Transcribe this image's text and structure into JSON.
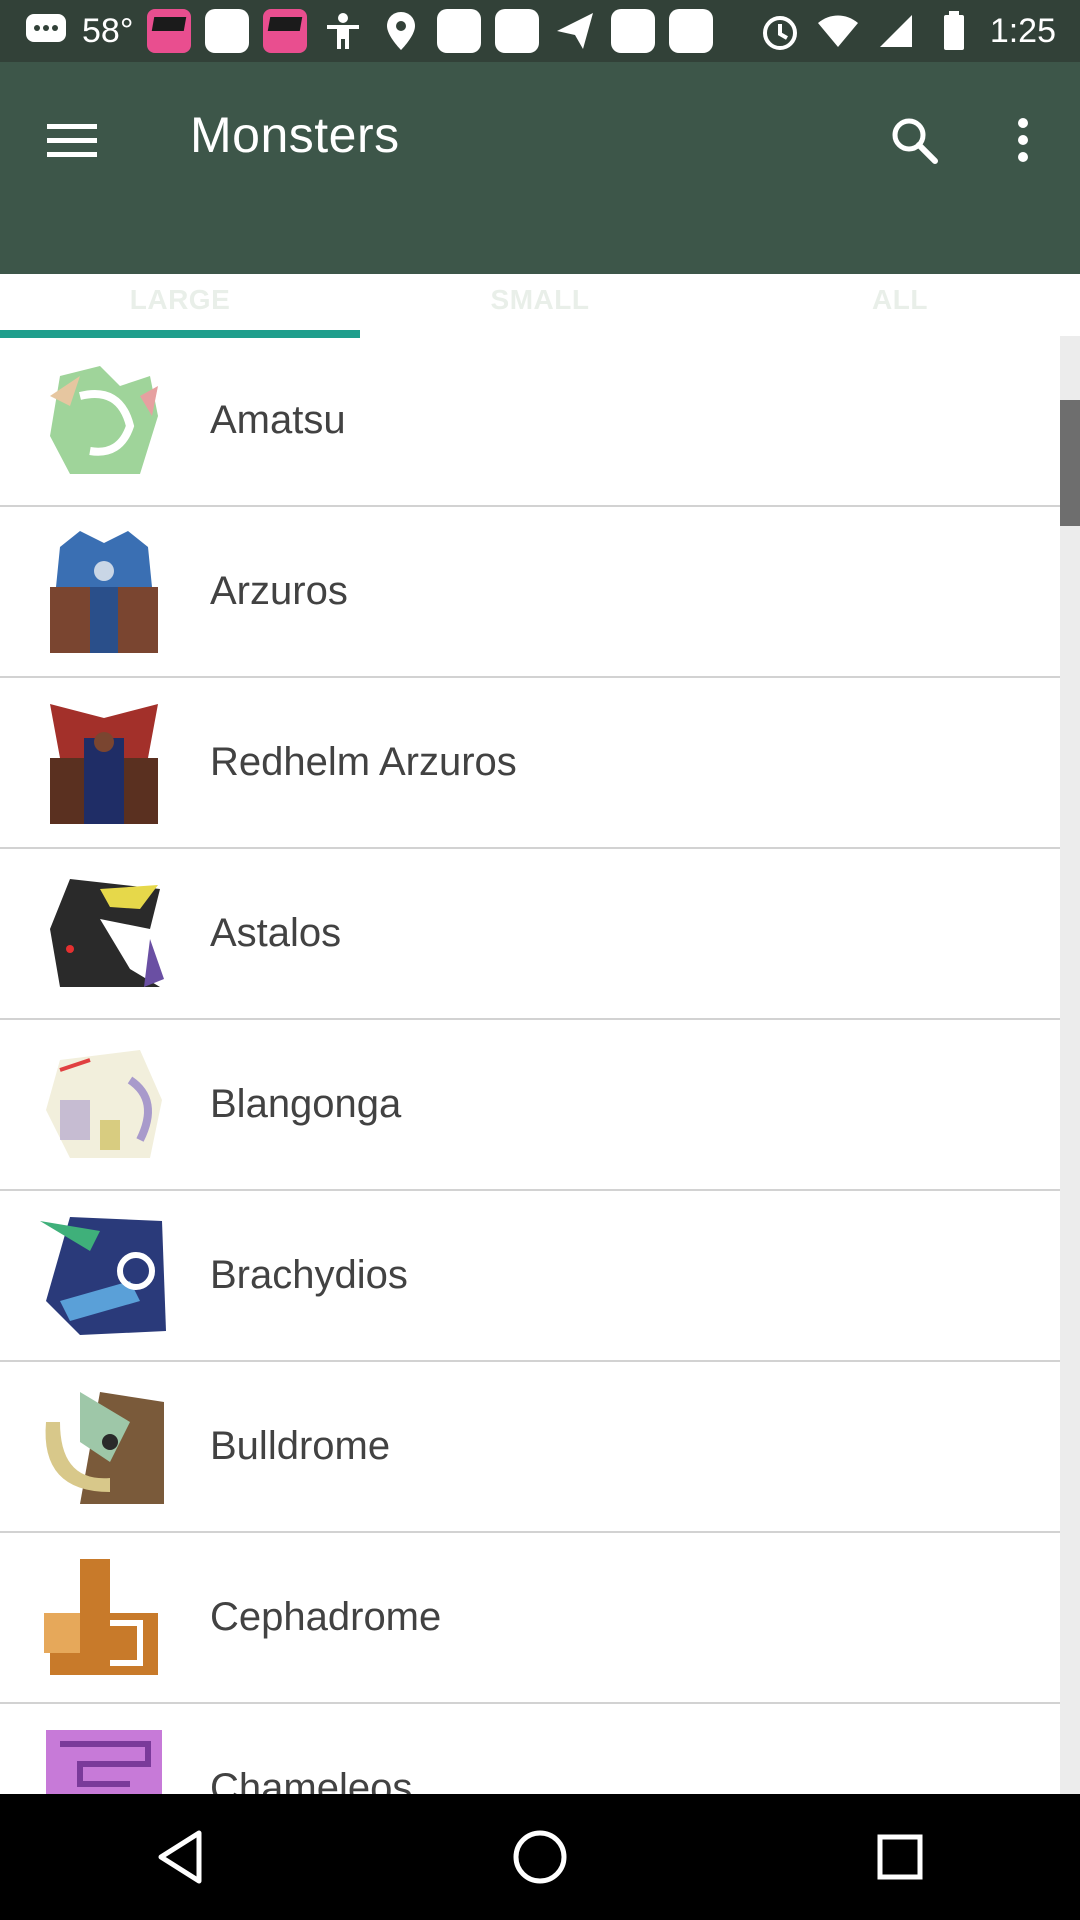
{
  "status_bar": {
    "temperature": "58°",
    "time": "1:25",
    "icons": [
      "messages-icon",
      "pop-app-icon",
      "square-app-icon",
      "pop-app-icon",
      "square-app-icon",
      "accessibility-icon",
      "location-icon",
      "square-app-icon",
      "square-app-icon",
      "send-icon",
      "square-app-icon",
      "square-app-icon",
      "alarm-icon",
      "wifi-icon",
      "signal-icon",
      "battery-icon"
    ]
  },
  "app_bar": {
    "title": "Monsters",
    "tabs": [
      {
        "label": "LARGE",
        "active": true
      },
      {
        "label": "SMALL",
        "active": false
      },
      {
        "label": "ALL",
        "active": false
      }
    ]
  },
  "monsters": [
    {
      "name": "Amatsu",
      "icon": "amatsu-icon",
      "colors": [
        "#9fd49a",
        "#e6c6a0",
        "#7bb07a"
      ]
    },
    {
      "name": "Arzuros",
      "icon": "arzuros-icon",
      "colors": [
        "#3a6fb3",
        "#7a4530",
        "#c9d6e6"
      ]
    },
    {
      "name": "Redhelm Arzuros",
      "icon": "redhelm-arzuros-icon",
      "colors": [
        "#1f2d66",
        "#a3302a",
        "#5a3020"
      ]
    },
    {
      "name": "Astalos",
      "icon": "astalos-icon",
      "colors": [
        "#2a2a2a",
        "#e6d84a",
        "#6a4fa3"
      ]
    },
    {
      "name": "Blangonga",
      "icon": "blangonga-icon",
      "colors": [
        "#f2efdc",
        "#a89acb",
        "#d8cc80"
      ]
    },
    {
      "name": "Brachydios",
      "icon": "brachydios-icon",
      "colors": [
        "#2a3a7a",
        "#3fb07a",
        "#5aa0d8"
      ]
    },
    {
      "name": "Bulldrome",
      "icon": "bulldrome-icon",
      "colors": [
        "#d8c88a",
        "#7a5a3a",
        "#9ec7a8"
      ]
    },
    {
      "name": "Cephadrome",
      "icon": "cephadrome-icon",
      "colors": [
        "#c87a2a",
        "#e6a85a",
        "#ffffff"
      ]
    },
    {
      "name": "Chameleos",
      "icon": "chameleos-icon",
      "colors": [
        "#c77ad8",
        "#7a3a9a",
        "#f0c8f0"
      ]
    }
  ]
}
